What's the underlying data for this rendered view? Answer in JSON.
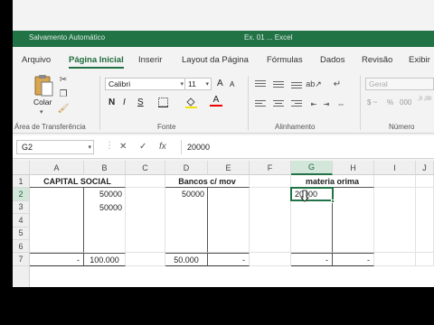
{
  "window": {
    "title_left": "Salvamento Automático",
    "title_mid": "Ex. 01 ... Excel"
  },
  "tabs": [
    "Arquivo",
    "Página Inicial",
    "Inserir",
    "Layout da Página",
    "Fórmulas",
    "Dados",
    "Revisão",
    "Exibir"
  ],
  "ribbon": {
    "paste_label": "Colar",
    "font_name": "Calibri",
    "font_size": "11",
    "number_format": "Geral",
    "groups": {
      "clipboard": "Área de Transferência",
      "font": "Fonte",
      "alignment": "Alinhamento",
      "number": "Número"
    },
    "bold": "N",
    "italic": "I",
    "underline": "S",
    "grow_font": "A",
    "shrink_font": "A",
    "font_color_letter": "A",
    "currency": "$ ~",
    "percent": "%",
    "thousands": "000",
    "increase_decimal": ",0 ,00",
    "decrease_decimal": ",00 ,0"
  },
  "formula_bar": {
    "cell_ref": "G2",
    "cancel": "✕",
    "enter": "✓",
    "fx": "fx",
    "value": "20000"
  },
  "grid": {
    "columns": [
      "A",
      "B",
      "C",
      "D",
      "E",
      "F",
      "G",
      "H",
      "I",
      "J"
    ],
    "rows": [
      "1",
      "2",
      "3",
      "4",
      "5",
      "6",
      "7"
    ],
    "cells": {
      "A1": "CAPITAL SOCIAL",
      "B2": "50000",
      "B3": "50000",
      "A7": "-",
      "B7": "100.000",
      "D1": "Bancos c/ mov",
      "D2": "50000",
      "D7": "50.000",
      "E7": "-",
      "G1": "materia orima",
      "G2": "20000",
      "G7": "-",
      "H7": "-"
    }
  },
  "colors": {
    "accent": "#217346",
    "selection": "#d3e6da"
  }
}
